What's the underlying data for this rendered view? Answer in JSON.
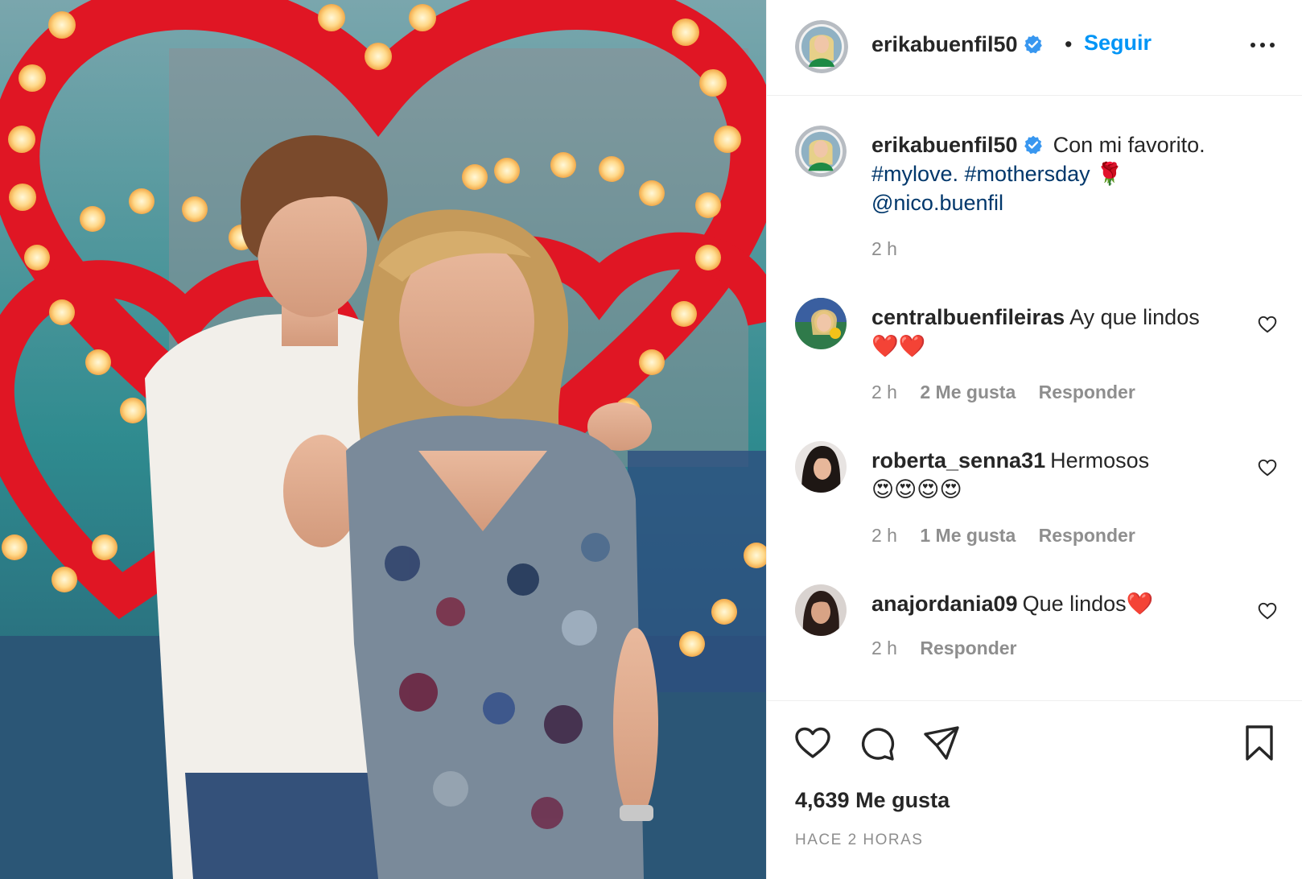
{
  "post": {
    "username": "erikabuenfil50",
    "separator": "•",
    "follow_label": "Seguir",
    "caption_text": "Con mi favorito.",
    "caption_hashtags": "#mylove. #mothersday",
    "caption_emoji": "🌹",
    "caption_mention": "@nico.buenfil",
    "caption_time": "2 h",
    "likes": "4,639 Me gusta",
    "posted": "HACE 2 HORAS"
  },
  "comments": [
    {
      "username": "centralbuenfileiras",
      "text": "Ay que lindos",
      "emoji": "❤️❤️",
      "time": "2 h",
      "likes": "2 Me gusta",
      "reply": "Responder"
    },
    {
      "username": "roberta_senna31",
      "text": "Hermosos",
      "emoji": "😍😍😍😍",
      "time": "2 h",
      "likes": "1 Me gusta",
      "reply": "Responder"
    },
    {
      "username": "anajordania09",
      "text": "Que lindos",
      "emoji": "❤️",
      "time": "2 h",
      "likes": "",
      "reply": "Responder"
    }
  ],
  "icons": {
    "verified": "verified-badge-icon",
    "more": "more-options-icon",
    "like": "heart-icon",
    "comment": "comment-icon",
    "share": "share-icon",
    "save": "bookmark-icon"
  },
  "colors": {
    "accent": "#0095f6",
    "link": "#00376b",
    "muted": "#8e8e8e",
    "verified": "#3897f0"
  }
}
